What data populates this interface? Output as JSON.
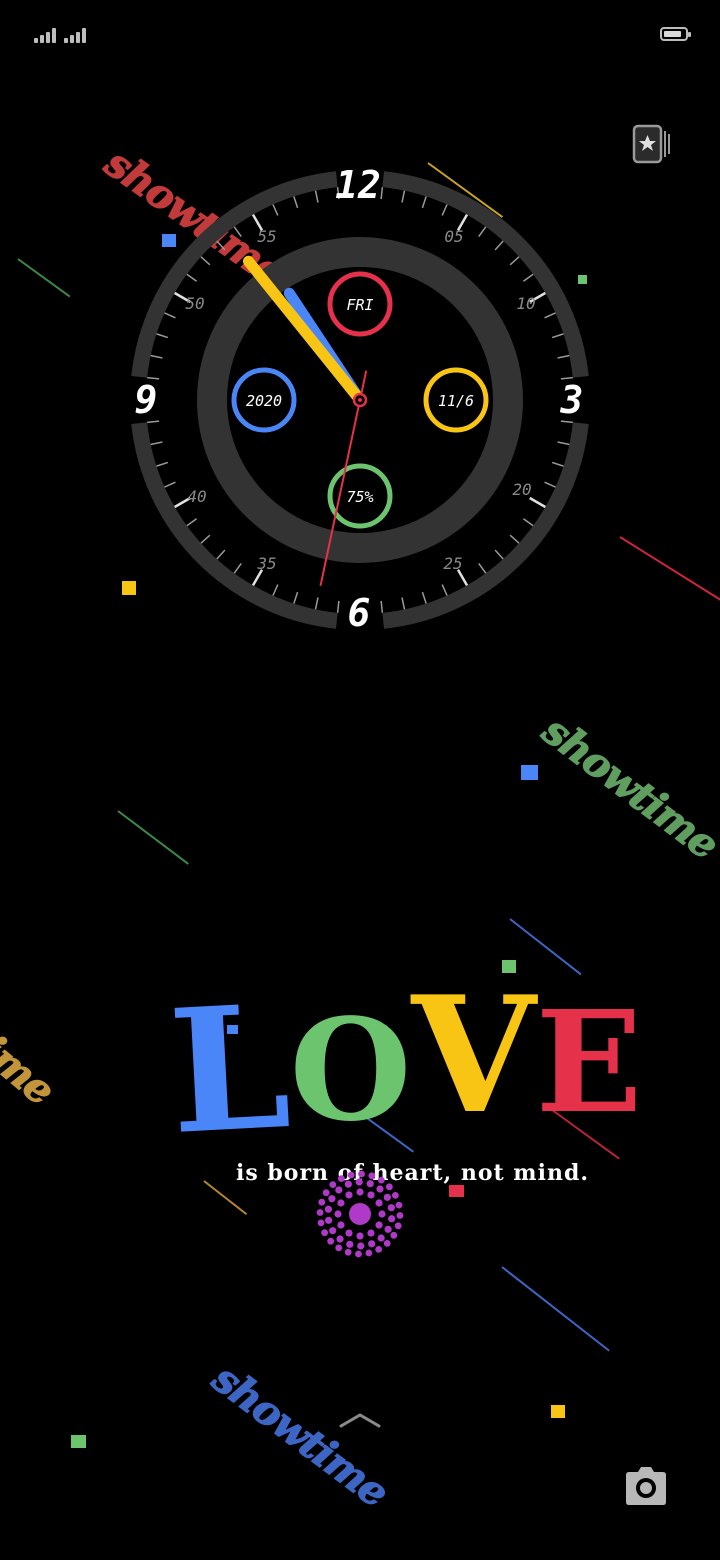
{
  "status_bar": {
    "battery_level": 0.85,
    "signal_bars": 4
  },
  "clock": {
    "hour_numerals": [
      "12",
      "3",
      "6",
      "9"
    ],
    "minute_numerals": [
      "05",
      "10",
      "20",
      "25",
      "35",
      "40",
      "50",
      "55"
    ],
    "day": "FRI",
    "year": "2020",
    "date": "11/6",
    "battery_percent": "75%",
    "time": {
      "hour": 10,
      "minute": 53,
      "second": 32
    }
  },
  "decor": {
    "showtime_text": "showtime",
    "love_letters": [
      "L",
      "O",
      "V",
      "E"
    ],
    "love_colors": [
      "#4a86f7",
      "#6cc46f",
      "#f9c515",
      "#e5314a"
    ],
    "tagline": "is born of heart, not mind."
  },
  "colors": {
    "blue": "#4a86f7",
    "green": "#6cc46f",
    "yellow": "#f9c515",
    "red": "#e5314a",
    "magenta": "#b03ac8",
    "ring": "#333333"
  },
  "icons": {
    "theme": "theme-store-icon",
    "camera": "camera-icon",
    "swipe": "chevron-up-icon"
  }
}
